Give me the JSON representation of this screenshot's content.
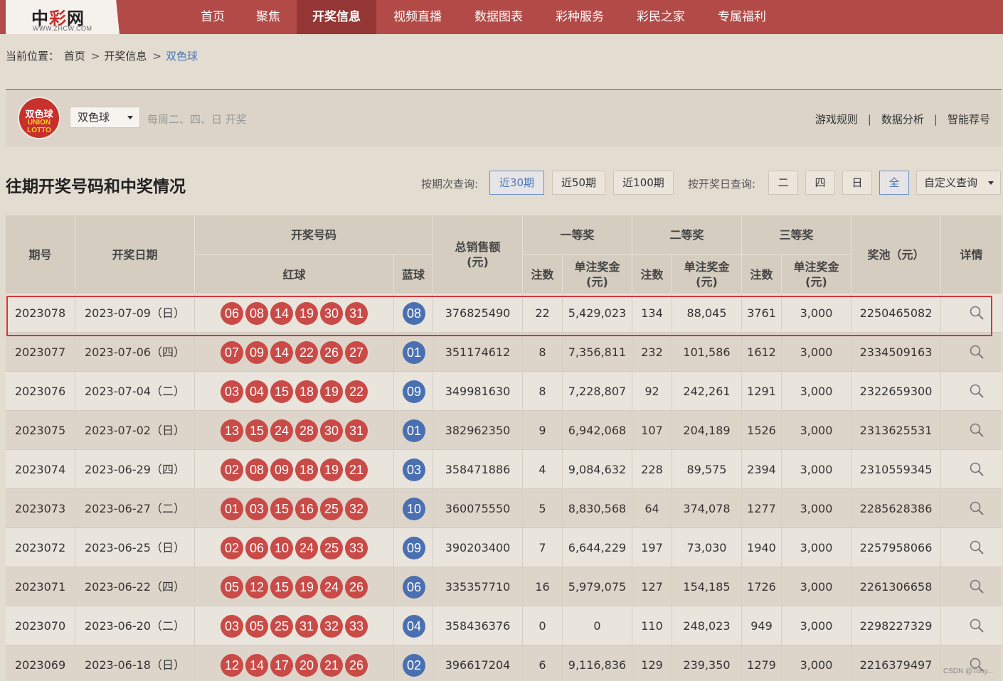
{
  "logo": {
    "name_black": "中",
    "name_red": "彩",
    "name_black2": "网",
    "domain": "WWW.ZHCW.COM"
  },
  "nav": [
    "首页",
    "聚焦",
    "开奖信息",
    "视频直播",
    "数据图表",
    "彩种服务",
    "彩民之家",
    "专属福利"
  ],
  "nav_active": "开奖信息",
  "breadcrumb": {
    "label": "当前位置：",
    "items": [
      "首页",
      "开奖信息",
      "双色球"
    ],
    "sep": ">"
  },
  "lottery": {
    "logo_text": "双色球",
    "logo_en1": "UNION",
    "logo_en2": "LOTTO",
    "select_value": "双色球",
    "schedule": "每周二、四、日 开奖",
    "links": [
      "游戏规则",
      "数据分析",
      "智能荐号"
    ],
    "link_sep": "|"
  },
  "section_title": "往期开奖号码和中奖情况",
  "filters": {
    "period_label": "按期次查询:",
    "period_options": [
      "近30期",
      "近50期",
      "近100期"
    ],
    "period_active": "近30期",
    "day_label": "按开奖日查询:",
    "day_options": [
      "二",
      "四",
      "日",
      "全"
    ],
    "day_active": "全",
    "custom": "自定义查询"
  },
  "table": {
    "headers": {
      "issue": "期号",
      "date": "开奖日期",
      "numbers": "开奖号码",
      "red": "红球",
      "blue": "蓝球",
      "sales": "总销售额\n(元)",
      "first": "一等奖",
      "second": "二等奖",
      "third": "三等奖",
      "count": "注数",
      "amount": "单注奖金\n(元)",
      "pool": "奖池（元）",
      "detail": "详情"
    },
    "rows": [
      {
        "issue": "2023078",
        "date": "2023-07-09（日）",
        "red": [
          "06",
          "08",
          "14",
          "19",
          "30",
          "31"
        ],
        "blue": "08",
        "sales": "376825490",
        "c1": "22",
        "a1": "5,429,023",
        "c2": "134",
        "a2": "88,045",
        "c3": "3761",
        "a3": "3,000",
        "pool": "2250465082"
      },
      {
        "issue": "2023077",
        "date": "2023-07-06（四）",
        "red": [
          "07",
          "09",
          "14",
          "22",
          "26",
          "27"
        ],
        "blue": "01",
        "sales": "351174612",
        "c1": "8",
        "a1": "7,356,811",
        "c2": "232",
        "a2": "101,586",
        "c3": "1612",
        "a3": "3,000",
        "pool": "2334509163"
      },
      {
        "issue": "2023076",
        "date": "2023-07-04（二）",
        "red": [
          "03",
          "04",
          "15",
          "18",
          "19",
          "22"
        ],
        "blue": "09",
        "sales": "349981630",
        "c1": "8",
        "a1": "7,228,807",
        "c2": "92",
        "a2": "242,261",
        "c3": "1291",
        "a3": "3,000",
        "pool": "2322659300"
      },
      {
        "issue": "2023075",
        "date": "2023-07-02（日）",
        "red": [
          "13",
          "15",
          "24",
          "28",
          "30",
          "31"
        ],
        "blue": "01",
        "sales": "382962350",
        "c1": "9",
        "a1": "6,942,068",
        "c2": "107",
        "a2": "204,189",
        "c3": "1526",
        "a3": "3,000",
        "pool": "2313625531"
      },
      {
        "issue": "2023074",
        "date": "2023-06-29（四）",
        "red": [
          "02",
          "08",
          "09",
          "18",
          "19",
          "21"
        ],
        "blue": "03",
        "sales": "358471886",
        "c1": "4",
        "a1": "9,084,632",
        "c2": "228",
        "a2": "89,575",
        "c3": "2394",
        "a3": "3,000",
        "pool": "2310559345"
      },
      {
        "issue": "2023073",
        "date": "2023-06-27（二）",
        "red": [
          "01",
          "03",
          "15",
          "16",
          "25",
          "32"
        ],
        "blue": "10",
        "sales": "360075550",
        "c1": "5",
        "a1": "8,830,568",
        "c2": "64",
        "a2": "374,078",
        "c3": "1277",
        "a3": "3,000",
        "pool": "2285628386"
      },
      {
        "issue": "2023072",
        "date": "2023-06-25（日）",
        "red": [
          "02",
          "06",
          "10",
          "24",
          "25",
          "33"
        ],
        "blue": "09",
        "sales": "390203400",
        "c1": "7",
        "a1": "6,644,229",
        "c2": "197",
        "a2": "73,030",
        "c3": "1940",
        "a3": "3,000",
        "pool": "2257958066"
      },
      {
        "issue": "2023071",
        "date": "2023-06-22（四）",
        "red": [
          "05",
          "12",
          "15",
          "19",
          "24",
          "26"
        ],
        "blue": "06",
        "sales": "335357710",
        "c1": "16",
        "a1": "5,979,075",
        "c2": "127",
        "a2": "154,185",
        "c3": "1726",
        "a3": "3,000",
        "pool": "2261306658"
      },
      {
        "issue": "2023070",
        "date": "2023-06-20（二）",
        "red": [
          "03",
          "05",
          "25",
          "31",
          "32",
          "33"
        ],
        "blue": "04",
        "sales": "358436376",
        "c1": "0",
        "a1": "0",
        "c2": "110",
        "a2": "248,023",
        "c3": "949",
        "a3": "3,000",
        "pool": "2298227329"
      },
      {
        "issue": "2023069",
        "date": "2023-06-18（日）",
        "red": [
          "12",
          "14",
          "17",
          "20",
          "21",
          "26"
        ],
        "blue": "02",
        "sales": "396617204",
        "c1": "6",
        "a1": "9,116,836",
        "c2": "129",
        "a2": "239,350",
        "c3": "1279",
        "a3": "3,000",
        "pool": "2216379497"
      }
    ]
  },
  "watermark": "CSDN @Tony..."
}
